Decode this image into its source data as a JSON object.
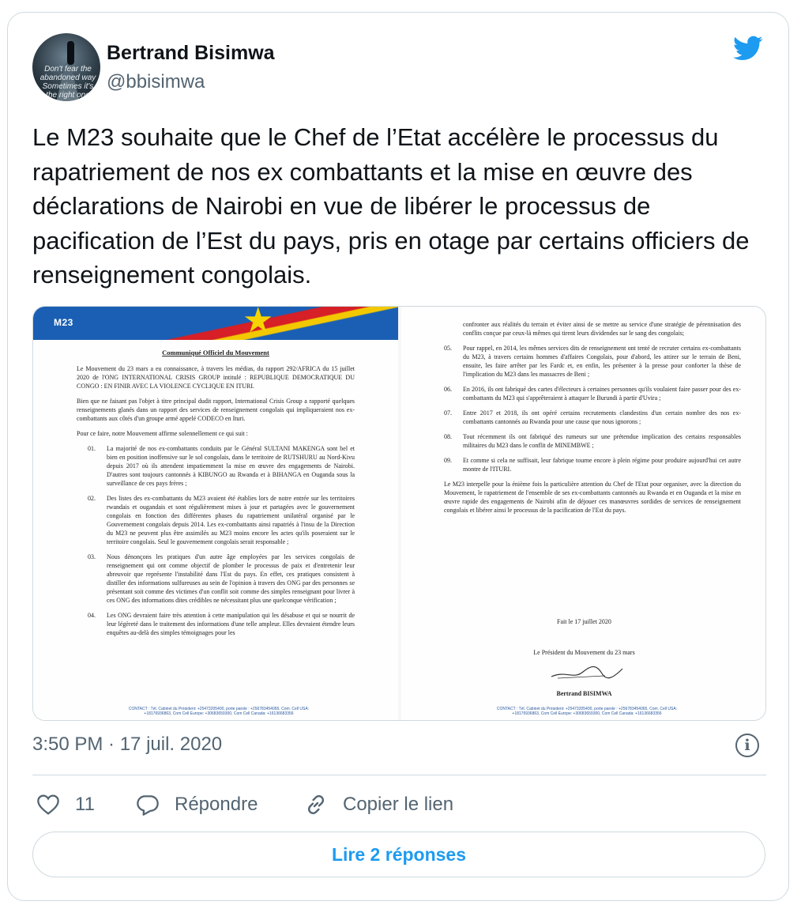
{
  "author": {
    "name": "Bertrand Bisimwa",
    "handle": "@bbisimwa",
    "avatar_caption": "Don't fear the abandoned way Sometimes it's the right one"
  },
  "tweet": {
    "text": "Le M23 souhaite que le Chef de l’Etat accélère le processus du rapatriement de nos ex combattants et la mise en œuvre des déclarations de Nairobi en vue de libérer le processus de pacification de l’Est du pays, pris en otage par certains officiers de renseignement congolais.",
    "timestamp": "3:50 PM · 17 juil. 2020"
  },
  "document": {
    "logo_tag": "M23",
    "title": "Communiqué Officiel du Mouvement",
    "intro1": "Le Mouvement du 23 mars a eu connaissance, à travers les médias, du rapport 292/AFRICA du 15 juillet 2020 de l'ONG INTERNATIONAL CRISIS GROUP intitulé : REPUBLIQUE DEMOCRATIQUE DU CONGO : EN FINIR AVEC LA VIOLENCE CYCLIQUE EN ITURI.",
    "intro2": "Bien que ne faisant pas l'objet à titre principal dudit rapport, International Crisis Group a rapporté quelques renseignements glanés dans un rapport des services de renseignement congolais qui impliqueraient nos ex-combattants aux côtés d'un groupe armé appelé CODECO en Ituri.",
    "intro3": "Pour ce faire, notre Mouvement affirme solennellement ce qui suit :",
    "points_left": [
      {
        "num": "01.",
        "text": "La majorité de nos ex-combattants conduits par le Général SULTANI MAKENGA sont bel et bien en position inoffensive sur le sol congolais, dans le territoire de RUTSHURU au Nord-Kivu depuis 2017 où ils attendent impatiemment la mise en œuvre des engagements de Nairobi. D'autres sont toujours cantonnés à KIBUNGO au Rwanda et à BIHANGA en Ouganda sous la surveillance de ces pays frères ;"
      },
      {
        "num": "02.",
        "text": "Des listes des ex-combattants du M23 avaient été établies lors de notre entrée sur les territoires rwandais et ougandais et sont régulièrement mises à jour et partagées avec le gouvernement congolais en fonction des différentes phases du rapatriement unilatéral organisé par le Gouvernement congolais depuis 2014. Les ex-combattants ainsi rapatriés à l'insu de la Direction du M23 ne peuvent plus être assimilés au M23 moins encore les actes qu'ils poseraient sur le territoire congolais. Seul le gouvernement congolais serait responsable ;"
      },
      {
        "num": "03.",
        "text": "Nous dénonçons les pratiques d'un autre âge employées par les services congolais de renseignement qui ont comme objectif de plomber le processus de paix et d'entretenir leur abreuvoir que représente l'instabilité dans l'Est du pays. En effet, ces pratiques consistent à distiller des informations sulfureuses au sein de l'opinion à travers des ONG par des personnes se présentant soit comme des victimes d'un conflit soit comme des simples renseignant pour livrer à ces ONG des informations dites crédibles ne nécessitant plus une quelconque vérification ;"
      },
      {
        "num": "04.",
        "text": "Les ONG devraient faire très attention à cette manipulation qui les désabuse et qui se nourrit de leur légèreté dans le traitement des informations d'une telle ampleur. Elles devraient étendre leurs enquêtes au-delà des simples témoignages pour les"
      }
    ],
    "continuation": "confronter aux réalités du terrain et éviter ainsi de se mettre au service d'une stratégie de pérennisation des conflits conçue par ceux-là mêmes qui tirent leurs dividendes sur le sang des congolais;",
    "points_right": [
      {
        "num": "05.",
        "text": "Pour rappel, en 2014, les mêmes services dits de renseignement ont tenté de recruter certains ex-combattants du M23, à travers certains hommes d'affaires Congolais, pour d'abord, les attirer sur le terrain de Beni, ensuite, les faire arrêter par les Fardc et, en enfin, les présenter à la presse pour conforter la thèse de l'implication du M23 dans les massacres de Beni ;"
      },
      {
        "num": "06.",
        "text": "En 2016, ils ont fabriqué des cartes d'électeurs à certaines personnes qu'ils voulaient faire passer pour des ex-combattants du M23 qui s'apprêteraient à attaquer le Burundi à partir d'Uvira ;"
      },
      {
        "num": "07.",
        "text": "Entre 2017 et 2018, ils ont opéré certains recrutements clandestins d'un certain nombre des nos ex-combattants cantonnés au Rwanda pour une cause que nous ignorons ;"
      },
      {
        "num": "08.",
        "text": "Tout récemment ils ont fabriqué des rumeurs sur une prétendue implication des certains responsables militaires du M23 dans le conflit de MINEMBWE ;"
      },
      {
        "num": "09.",
        "text": "Et comme si cela ne suffisait, leur fabrique tourne encore à plein régime pour produire aujourd'hui cet autre montre de l'ITURI."
      }
    ],
    "closing": "Le M23 interpelle pour la énième fois la particulière attention du Chef de l'Etat pour organiser, avec la direction du Mouvement, le rapatriement de l'ensemble de ses ex-combattants cantonnés au Rwanda et en Ouganda et la mise en œuvre rapide des engagements de Nairobi afin de déjouer ces manœuvres sordides de services de renseignement congolais et libérer ainsi le processus de la pacification de l'Est du pays.",
    "date_line": "Fait le 17 juillet 2020",
    "signatory_title": "Le Président du Mouvement du 23 mars",
    "signatory_name": "Bertrand BISIMWA",
    "footer_left": "CONTACT : Tél. Cabinet du Président: +25473205400, porte parole : +256783454065, Com. Cell USA: +18176936863, Com Cell Europe: +30683659300, Com Cell Canada: +16136683356",
    "footer_right": "CONTACT : Tél. Cabinet du Président: +25473205400, porte parole : +256783454065, Com. Cell USA: +18176936863, Com Cell Europe: +30683659300, Com Cell Canada: +16136683356"
  },
  "actions": {
    "like_count": "11",
    "reply_label": "Répondre",
    "copy_label": "Copier le lien",
    "read_replies": "Lire 2 réponses"
  },
  "colors": {
    "accent": "#1d9bf0",
    "muted": "#536471",
    "border": "#cfd9de"
  },
  "icons": [
    "twitter-bird-icon",
    "info-icon",
    "heart-icon",
    "reply-icon",
    "link-icon"
  ]
}
